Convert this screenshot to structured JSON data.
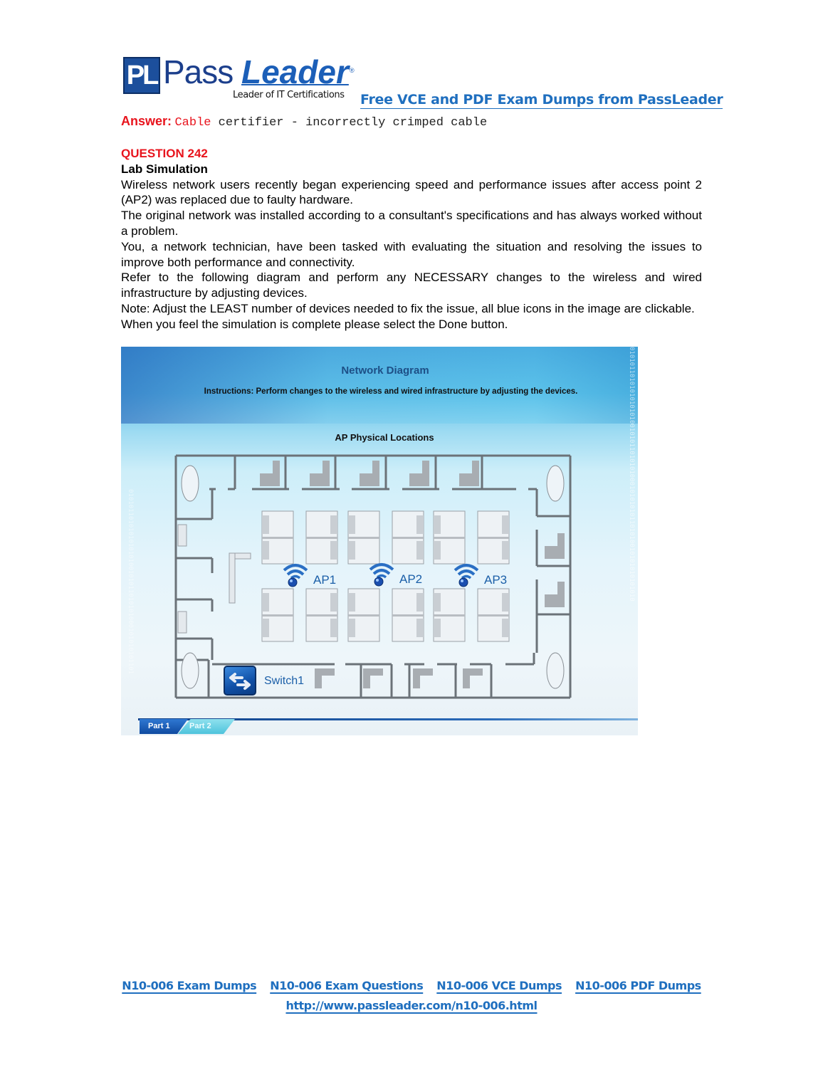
{
  "header": {
    "logo_mark": "PL",
    "logo_pass": "Pass",
    "logo_leader": "Leader",
    "logo_registered": "®",
    "logo_tagline": "Leader of IT Certifications",
    "promo_link": "Free VCE and PDF Exam Dumps from PassLeader"
  },
  "answer": {
    "label": "Answer:",
    "text_red": "Cable",
    "text_rest": " certifier - incorrectly crimped cable"
  },
  "question": {
    "number": "QUESTION 242",
    "type": "Lab Simulation",
    "paragraphs": [
      "Wireless network users recently began experiencing speed and performance issues after access point 2 (AP2) was replaced due to faulty hardware.",
      "The original network was installed according to a consultant's specifications and has always worked without a problem.",
      "You, a network technician, have been tasked with evaluating the situation and resolving the issues to improve both performance and connectivity.",
      "Refer to the following diagram and perform any NECESSARY changes to the wireless and wired infrastructure by adjusting devices.",
      "Note: Adjust the LEAST number of devices needed to fix the issue, all blue icons in the image are clickable.",
      "When you feel the simulation is complete please select the Done button."
    ]
  },
  "simulation": {
    "title": "Network Diagram",
    "instructions": "Instructions: Perform changes to the wireless and wired infrastructure by adjusting the devices.",
    "section_label": "AP Physical Locations",
    "binary_text": "010101101010101010100101011010101000101010101101010010101010101010",
    "access_points": [
      {
        "label": "AP1",
        "icon": "wifi-access-point-icon"
      },
      {
        "label": "AP2",
        "icon": "wifi-access-point-icon"
      },
      {
        "label": "AP3",
        "icon": "wifi-access-point-icon"
      }
    ],
    "switch": {
      "label": "Switch1",
      "icon": "network-switch-icon"
    },
    "tabs": [
      {
        "label": "Part 1",
        "active": true
      },
      {
        "label": "Part 2",
        "active": false
      }
    ],
    "colors": {
      "device_blue": "#1b5fa8",
      "wall": "#6b7278",
      "title_blue": "#1d4f86"
    }
  },
  "footer": {
    "links": [
      "N10-006 Exam Dumps",
      "N10-006 Exam Questions",
      "N10-006 VCE Dumps",
      "N10-006 PDF Dumps"
    ],
    "url": "http://www.passleader.com/n10-006.html"
  },
  "colors": {
    "accent_red": "#e8141d",
    "link_blue": "#1f6fbf",
    "logo_blue": "#1c4f9c"
  }
}
